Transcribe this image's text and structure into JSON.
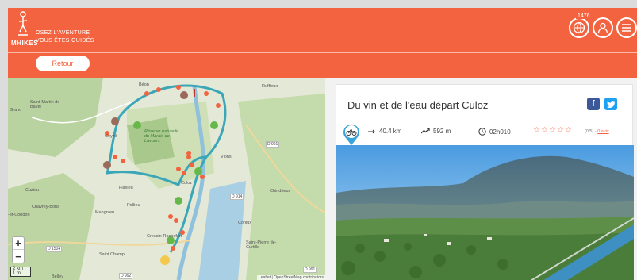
{
  "header": {
    "logo_text": "MHIKES",
    "tagline_1": "OSEZ L'AVENTURE",
    "tagline_2": "VOUS ÊTES GUIDÉS",
    "badge_count": "1476",
    "back_label": "Retour"
  },
  "map": {
    "places": [
      "Béon",
      "Saint-Martin de-Bavel",
      "Ceyzé",
      "Culoz",
      "Cuzieu",
      "Chavrey-Bons",
      "Flaxieu",
      "Pollieu",
      "Mangnieu",
      "Chindrieux",
      "Ruffieux",
      "Cressin-Rochefort",
      "Saint Champ",
      "Saint-Pierre de-Curtille",
      "Conjux",
      "Belley",
      "Grand",
      "-et-Condon",
      "Réserve naturelle du Marais de Lavours",
      "Vions"
    ],
    "roads": [
      "D 991",
      "D 914",
      "D 1504",
      "D 992",
      "D 991"
    ],
    "zoom_in": "+",
    "zoom_out": "−",
    "scale_km": "2 km",
    "scale_mi": "1 mi",
    "attribution": "Leaflet | OpenStreetMap contributors"
  },
  "trail": {
    "title": "Du vin et de l'eau départ Culoz",
    "distance": "40.4 km",
    "elevation": "592 m",
    "duration": "02h010",
    "stars": "☆☆☆☆☆",
    "rating": "(0/5) - ",
    "rating_link": "0 avis"
  },
  "icons": {
    "logo": "hiker-logo-icon",
    "globe": "globe-icon",
    "user": "user-icon",
    "menu": "menu-icon",
    "facebook": "facebook-icon",
    "twitter": "twitter-icon",
    "bike": "bike-icon",
    "distance": "arrow-right-icon",
    "elevation": "trend-up-icon",
    "duration": "clock-icon"
  },
  "colors": {
    "brand": "#f4633f",
    "route": "#3ba6b8",
    "facebook": "#3b5998",
    "twitter": "#1da1f2"
  }
}
